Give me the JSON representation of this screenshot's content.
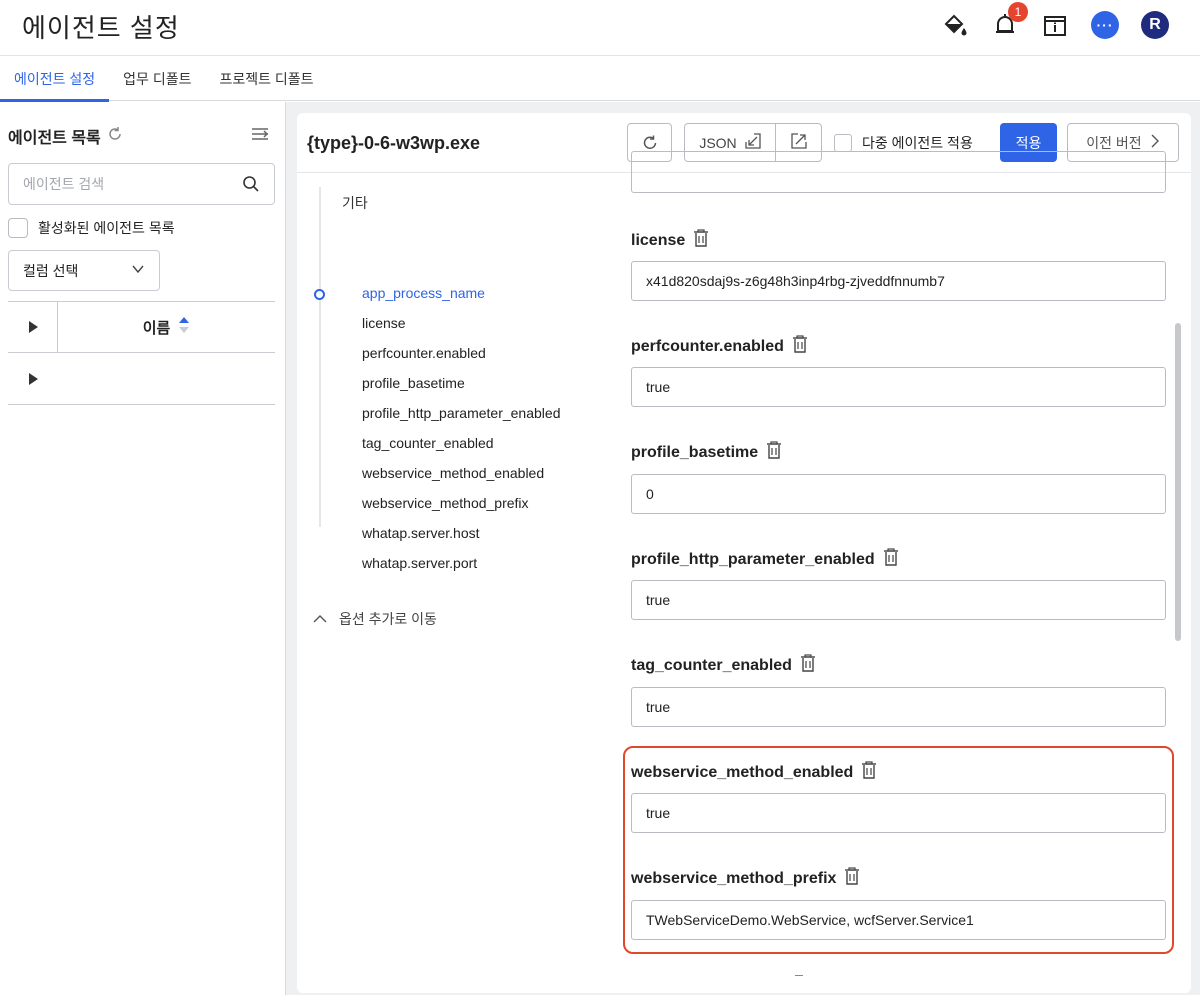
{
  "header": {
    "title": "에이전트 설정",
    "notification_count": "1",
    "avatar_letter": "R",
    "chat_glyph": "···"
  },
  "tabs": [
    {
      "label": "에이전트 설정",
      "active": true
    },
    {
      "label": "업무 디폴트",
      "active": false
    },
    {
      "label": "프로젝트 디폴트",
      "active": false
    }
  ],
  "agent_list": {
    "title": "에이전트 목록",
    "search_placeholder": "에이전트 검색",
    "active_only_label": "활성화된 에이전트 목록",
    "column_select_label": "컬럼 선택",
    "table_header_name": "이름"
  },
  "agent": {
    "name": "{type}-0-6-w3wp.exe",
    "json_label": "JSON",
    "multi_apply_label": "다중 에이전트 적용",
    "apply_label": "적용",
    "prev_version_label": "이전 버전"
  },
  "nav": {
    "group": "기타",
    "items": [
      {
        "label": "app_process_name",
        "active": true
      },
      {
        "label": "license",
        "active": false
      },
      {
        "label": "perfcounter.enabled",
        "active": false
      },
      {
        "label": "profile_basetime",
        "active": false
      },
      {
        "label": "profile_http_parameter_enabled",
        "active": false
      },
      {
        "label": "tag_counter_enabled",
        "active": false
      },
      {
        "label": "webservice_method_enabled",
        "active": false
      },
      {
        "label": "webservice_method_prefix",
        "active": false
      },
      {
        "label": "whatap.server.host",
        "active": false
      },
      {
        "label": "whatap.server.port",
        "active": false
      }
    ],
    "more_label": "옵션 추가로 이동"
  },
  "fields": [
    {
      "key": "license",
      "value": "x41d820sdaj9s-z6g48h3inp4rbg-zjveddfnnumb7"
    },
    {
      "key": "perfcounter.enabled",
      "value": "true"
    },
    {
      "key": "profile_basetime",
      "value": "0"
    },
    {
      "key": "profile_http_parameter_enabled",
      "value": "true"
    },
    {
      "key": "tag_counter_enabled",
      "value": "true"
    },
    {
      "key": "webservice_method_enabled",
      "value": "true"
    },
    {
      "key": "webservice_method_prefix",
      "value": "TWebServiceDemo.WebService, wcfServer.Service1"
    }
  ],
  "colors": {
    "accent": "#2f64e6",
    "highlight": "#e0472d",
    "badge": "#e5452f",
    "avatar": "#1e2b7e"
  }
}
